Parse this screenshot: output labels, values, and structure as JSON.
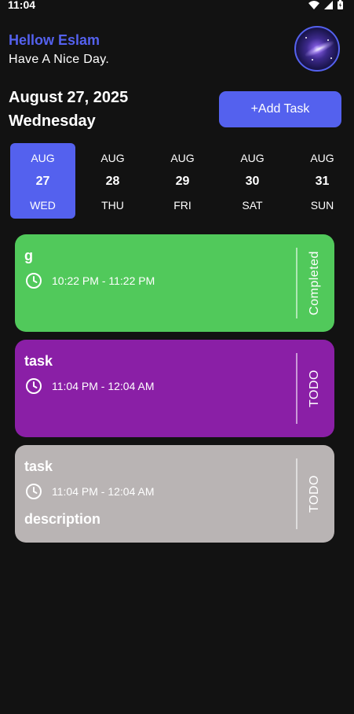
{
  "status_bar": {
    "time": "11:04"
  },
  "header": {
    "greeting_name": "Hellow Eslam",
    "greeting_subtitle": "Have A Nice Day.",
    "date": "August 27, 2025",
    "weekday": "Wednesday",
    "add_task_label": "+Add Task"
  },
  "date_strip": [
    {
      "month": "AUG",
      "day": "27",
      "weekday": "WED",
      "selected": true
    },
    {
      "month": "AUG",
      "day": "28",
      "weekday": "THU",
      "selected": false
    },
    {
      "month": "AUG",
      "day": "29",
      "weekday": "FRI",
      "selected": false
    },
    {
      "month": "AUG",
      "day": "30",
      "weekday": "SAT",
      "selected": false
    },
    {
      "month": "AUG",
      "day": "31",
      "weekday": "SUN",
      "selected": false
    }
  ],
  "tasks": [
    {
      "title": "g",
      "time": "10:22 PM - 11:22 PM",
      "description": "",
      "status": "Completed",
      "color": "#51C95B"
    },
    {
      "title": "task",
      "time": "11:04 PM - 12:04 AM",
      "description": "",
      "status": "TODO",
      "color": "#8A1FA6"
    },
    {
      "title": "task",
      "time": "11:04 PM - 12:04 AM",
      "description": "description",
      "status": "TODO",
      "color": "#B9B4B4"
    }
  ],
  "colors": {
    "accent": "#5461EE",
    "background": "#121212"
  },
  "icons": {
    "status_bar": [
      "wifi-icon",
      "cell-signal-icon",
      "battery-icon"
    ],
    "task_time": "clock-icon"
  }
}
